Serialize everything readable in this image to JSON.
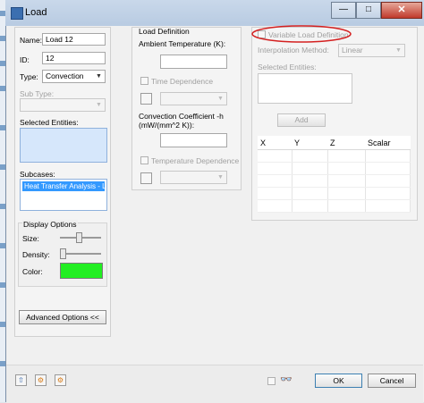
{
  "window": {
    "title": "Load"
  },
  "left_panel": {
    "name_label": "Name:",
    "name_value": "Load 12",
    "id_label": "ID:",
    "id_value": "12",
    "type_label": "Type:",
    "type_value": "Convection",
    "subtype_label": "Sub Type:",
    "selected_entities_label": "Selected Entities:",
    "subcases_label": "Subcases:",
    "subcase_item": "Heat Transfer Analysis - Lin",
    "display_options": {
      "title": "Display Options",
      "size_label": "Size:",
      "size_level": 0.45,
      "density_label": "Density:",
      "density_level": 0.0,
      "color_label": "Color:",
      "color_value": "#22ee22"
    },
    "advanced_button": "Advanced Options <<"
  },
  "load_definition": {
    "title": "Load Definition",
    "ambient_label": "Ambient Temperature (K):",
    "time_dependence_label": "Time Dependence",
    "conv_label_line1": "Convection Coefficient -h",
    "conv_label_line2": "(mW/(mm^2 K)):",
    "temp_dependence_label": "Temperature Dependence"
  },
  "variable_panel": {
    "variable_label": "Variable Load Definition",
    "interp_label": "Interpolation Method:",
    "interp_value": "Linear",
    "selected_entities_label": "Selected Entities:",
    "add_button": "Add",
    "table_headers": [
      "X",
      "Y",
      "Z",
      "Scalar"
    ]
  },
  "footer": {
    "ok_button": "OK",
    "cancel_button": "Cancel"
  },
  "colors": {
    "highlight_circle": "#d42020",
    "selection_box": "#d6e7fb"
  }
}
